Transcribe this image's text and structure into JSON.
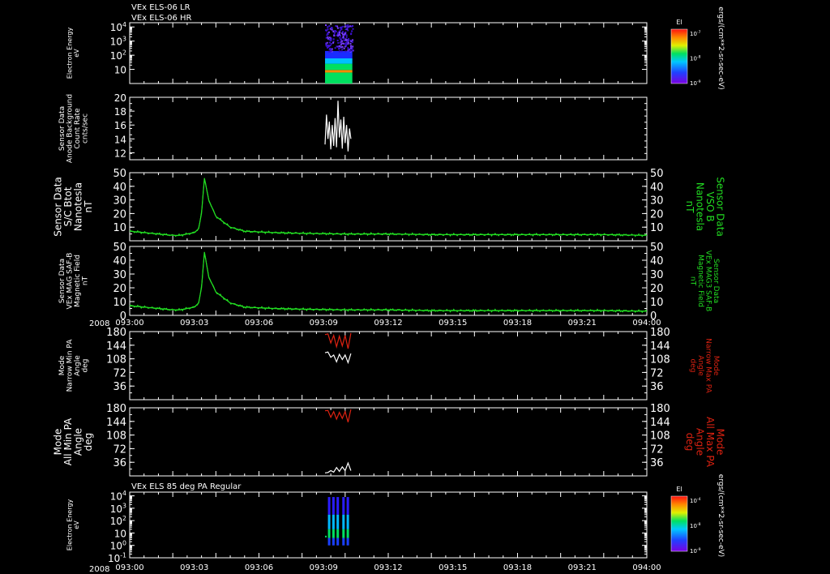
{
  "window": {
    "title_lines": [
      "VEx ELS-06 LR",
      "VEx ELS-06 HR"
    ],
    "year": "2008"
  },
  "colors": {
    "background": "#000000",
    "axes": "#ffffff",
    "green": "#22dd22",
    "red": "#dd2211",
    "white": "#ffffff"
  },
  "time_axis": {
    "ticks": [
      "093:00",
      "093:03",
      "093:06",
      "093:09",
      "093:12",
      "093:15",
      "093:18",
      "093:21",
      "094:00"
    ],
    "range_minutes": [
      0,
      36
    ]
  },
  "chart_data": [
    {
      "type": "heatmap",
      "id": "els-lr-hr-spectrogram",
      "ylabel": [
        "Electron Energy",
        "eV"
      ],
      "yscale": "log",
      "ylim": [
        1,
        20000
      ],
      "yticks": [
        {
          "m": "10",
          "e": ""
        },
        {
          "m": "10",
          "e": "2"
        },
        {
          "m": "10",
          "e": "3"
        },
        {
          "m": "10",
          "e": "4"
        }
      ],
      "colorbar": {
        "title": "El",
        "tick_labels": [
          {
            "m": "10",
            "e": "-7"
          },
          {
            "m": "10",
            "e": "-8"
          },
          {
            "m": "10",
            "e": "-9"
          }
        ],
        "units": "ergs/(cm**2-sr-sec-eV)"
      },
      "data_window_minutes": [
        13.6,
        15.5
      ],
      "bands": [
        {
          "e_lo": 1,
          "e_hi": 4,
          "level": 0.5
        },
        {
          "e_lo": 4,
          "e_hi": 6,
          "level": 0.55
        },
        {
          "e_lo": 6,
          "e_hi": 9,
          "level": 0.85
        },
        {
          "e_lo": 9,
          "e_hi": 14,
          "level": 0.5
        },
        {
          "e_lo": 14,
          "e_hi": 25,
          "level": 0.42
        },
        {
          "e_lo": 25,
          "e_hi": 60,
          "level": 0.28
        },
        {
          "e_lo": 60,
          "e_hi": 200,
          "level": 0.12
        }
      ]
    },
    {
      "type": "line",
      "id": "anode-background",
      "ylabel": [
        "Sensor Data",
        "Anode Background",
        "Count Rate",
        "cnts/sec"
      ],
      "ylim": [
        11,
        20
      ],
      "yticks": [
        "12",
        "14",
        "16",
        "18",
        "20"
      ],
      "series": [
        {
          "color": "#ffffff",
          "x": [
            13.6,
            13.7,
            13.8,
            13.9,
            14.0,
            14.1,
            14.2,
            14.3,
            14.4,
            14.5,
            14.6,
            14.7,
            14.8,
            14.9,
            15.0,
            15.1,
            15.2,
            15.3,
            15.4
          ],
          "y": [
            13.2,
            17.5,
            14.0,
            16.5,
            12.5,
            16.0,
            13.0,
            17.0,
            12.8,
            19.5,
            14.2,
            16.8,
            12.6,
            17.2,
            13.4,
            16.0,
            12.2,
            15.5,
            14.0
          ]
        }
      ]
    },
    {
      "type": "line",
      "id": "sc-bmag",
      "ylabel": [
        "Sensor Data",
        "S/C Btot",
        "Nanotesla",
        "nT"
      ],
      "ylabel_right": [
        "Sensor Data",
        "VSO B",
        "Nanotesla",
        "nT"
      ],
      "ylim": [
        0,
        50
      ],
      "yticks": [
        "10",
        "20",
        "30",
        "40",
        "50"
      ],
      "series": [
        {
          "color": "#22dd22",
          "x": [
            0,
            1,
            2,
            3,
            3.5,
            4,
            4.5,
            4.8,
            5,
            5.2,
            5.5,
            6,
            7,
            8,
            10,
            12,
            15,
            18,
            21,
            24,
            27,
            30,
            33,
            36
          ],
          "y": [
            7,
            6,
            5,
            4,
            4,
            5,
            6,
            9,
            20,
            46,
            30,
            18,
            10,
            7,
            6,
            5.5,
            5,
            5,
            4.5,
            4.5,
            4.5,
            4.5,
            4.5,
            4
          ]
        }
      ]
    },
    {
      "type": "line",
      "id": "mag-safe-b",
      "ylabel": [
        "Sensor Data",
        "VEx MAG SAF-B",
        "Magnetic Field",
        "nT"
      ],
      "ylabel_right": [
        "Sensor Data",
        "VEx MAG3 SAF-B",
        "Magnetic Field",
        "nT"
      ],
      "ylim": [
        0,
        50
      ],
      "yticks": [
        "0",
        "10",
        "20",
        "30",
        "40",
        "50"
      ],
      "series": [
        {
          "color": "#22dd22",
          "x": [
            0,
            1,
            2,
            3,
            3.5,
            4,
            4.5,
            4.8,
            5,
            5.2,
            5.5,
            6,
            7,
            8,
            10,
            12,
            15,
            18,
            21,
            24,
            27,
            30,
            33,
            36
          ],
          "y": [
            7,
            6,
            5,
            4,
            4,
            5,
            6,
            9,
            20,
            46,
            28,
            17,
            9,
            6,
            5,
            4.5,
            4,
            4,
            3.5,
            3.5,
            3.5,
            3.5,
            3.5,
            3
          ]
        }
      ]
    },
    {
      "type": "line",
      "id": "narrow-pa",
      "ylabel": [
        "Mode",
        "Narrow Min PA",
        "Angle",
        "deg"
      ],
      "ylabel_right": [
        "Mode",
        "Narrow Max PA",
        "Angle",
        "deg"
      ],
      "ylim": [
        0,
        180
      ],
      "yticks": [
        "36",
        "72",
        "108",
        "144",
        "180"
      ],
      "series": [
        {
          "color": "#dd2211",
          "x": [
            13.6,
            13.8,
            14.0,
            14.2,
            14.4,
            14.6,
            14.8,
            15.0,
            15.2,
            15.4
          ],
          "y": [
            172,
            174,
            150,
            170,
            140,
            168,
            142,
            170,
            135,
            176
          ]
        },
        {
          "color": "#ffffff",
          "x": [
            13.6,
            13.8,
            14.0,
            14.2,
            14.4,
            14.6,
            14.8,
            15.0,
            15.2,
            15.4
          ],
          "y": [
            124,
            126,
            112,
            118,
            100,
            120,
            106,
            118,
            98,
            122
          ]
        }
      ]
    },
    {
      "type": "line",
      "id": "all-pa",
      "ylabel": [
        "Mode",
        "All Min PA",
        "Angle",
        "deg"
      ],
      "ylabel_right": [
        "Mode",
        "All Max PA",
        "Angle",
        "deg"
      ],
      "ylim": [
        0,
        180
      ],
      "yticks": [
        "36",
        "72",
        "108",
        "144",
        "180"
      ],
      "series": [
        {
          "color": "#dd2211",
          "x": [
            13.6,
            13.8,
            14.0,
            14.2,
            14.4,
            14.6,
            14.8,
            15.0,
            15.2,
            15.4
          ],
          "y": [
            172,
            173,
            155,
            170,
            150,
            168,
            152,
            170,
            142,
            176
          ]
        },
        {
          "color": "#ffffff",
          "x": [
            13.6,
            13.8,
            14.0,
            14.2,
            14.4,
            14.6,
            14.8,
            15.0,
            15.2,
            15.4
          ],
          "y": [
            8,
            9,
            14,
            10,
            22,
            12,
            24,
            14,
            34,
            14
          ]
        }
      ]
    },
    {
      "type": "heatmap",
      "id": "els-85deg-pa",
      "title": "VEx ELS 85 deg PA Regular",
      "ylabel": [
        "Electron Energy",
        "eV"
      ],
      "yscale": "log",
      "ylim": [
        0.1,
        20000
      ],
      "yticks": [
        {
          "m": "10",
          "e": "-1"
        },
        {
          "m": "10",
          "e": "0"
        },
        {
          "m": "10",
          "e": ""
        },
        {
          "m": "10",
          "e": "2"
        },
        {
          "m": "10",
          "e": "3"
        },
        {
          "m": "10",
          "e": "4"
        }
      ],
      "colorbar": {
        "title": "El",
        "tick_labels": [
          {
            "m": "10",
            "e": "-4"
          },
          {
            "m": "10",
            "e": "-8"
          },
          {
            "m": "10",
            "e": "-9"
          }
        ],
        "units": "ergs/(cm**2-sr-sec-eV)"
      },
      "strips": [
        {
          "t": 13.8,
          "w": 0.12
        },
        {
          "t": 14.1,
          "w": 0.14
        },
        {
          "t": 14.4,
          "w": 0.12
        },
        {
          "t": 14.8,
          "w": 0.12
        },
        {
          "t": 15.1,
          "w": 0.14
        }
      ]
    }
  ]
}
